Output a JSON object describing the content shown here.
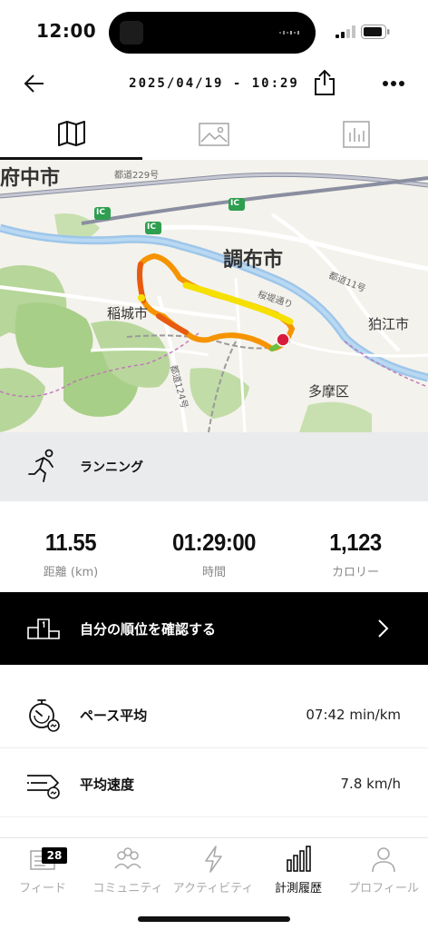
{
  "status_bar": {
    "time": "12:00"
  },
  "header": {
    "title": "2025/04/19 - 10:29",
    "back_icon": "arrow-left-icon",
    "share_icon": "share-icon",
    "more_icon": "more-dots-icon"
  },
  "tabs": [
    {
      "icon": "map-icon",
      "active": true
    },
    {
      "icon": "image-icon",
      "active": false
    },
    {
      "icon": "bar-chart-icon",
      "active": false
    }
  ],
  "map": {
    "labels": {
      "fuchu": "府中市",
      "chofu": "調布市",
      "inagi": "稲城市",
      "komae": "狛江市",
      "tama": "多摩区",
      "road_229": "都道229号",
      "road_11": "都道11号",
      "sakurazutsumi": "桜堤通り",
      "road_124": "都道124号",
      "ic_1": "IC",
      "ic_2": "IC",
      "ic_3": "IC"
    },
    "route_colors": [
      "#f5e000",
      "#f59300",
      "#e85a10",
      "#6fbf3f"
    ],
    "end_marker_color": "#d81b3a"
  },
  "activity": {
    "type": "ランニング",
    "icon": "runner-icon"
  },
  "stats": [
    {
      "value": "11.55",
      "label": "距離 (km)"
    },
    {
      "value": "01:29:00",
      "label": "時間"
    },
    {
      "value": "1,123",
      "label": "カロリー"
    }
  ],
  "ranking": {
    "label": "自分の順位を確認する",
    "icon": "podium-icon"
  },
  "metrics": [
    {
      "label": "ペース平均",
      "value": "07:42 min/km",
      "icon": "stopwatch-icon"
    },
    {
      "label": "平均速度",
      "value": "7.8 km/h",
      "icon": "speed-icon"
    }
  ],
  "bottom_nav": [
    {
      "label": "フィード",
      "icon": "feed-icon",
      "badge": "28",
      "active": false
    },
    {
      "label": "コミュニティ",
      "icon": "community-icon",
      "active": false
    },
    {
      "label": "アクティビティ",
      "icon": "lightning-icon",
      "active": false
    },
    {
      "label": "計測履歴",
      "icon": "history-chart-icon",
      "active": true
    },
    {
      "label": "プロフィール",
      "icon": "profile-icon",
      "active": false
    }
  ]
}
